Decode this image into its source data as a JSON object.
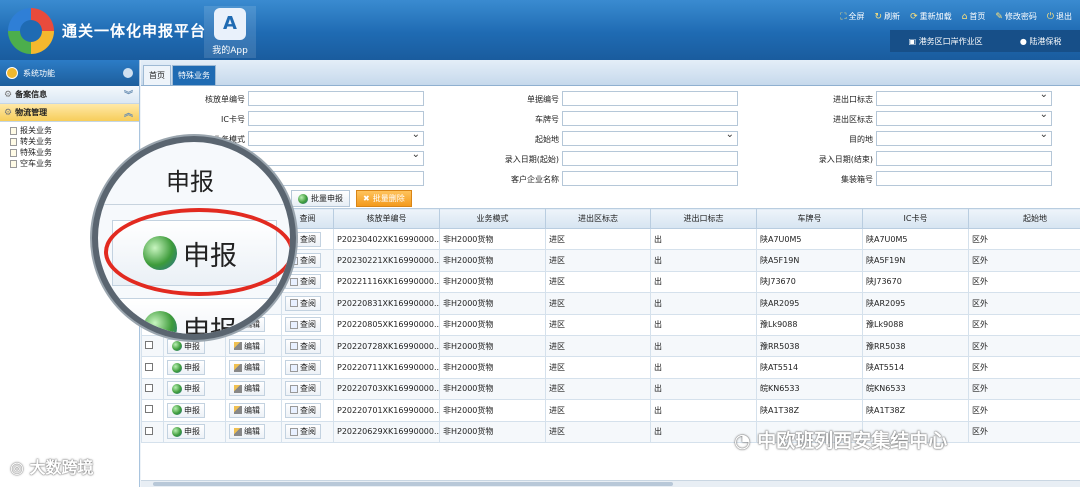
{
  "header": {
    "title": "通关一体化申报平台",
    "myapp_label": "我的App",
    "links": [
      {
        "icon": "fullscreen-icon",
        "label": "全屏"
      },
      {
        "icon": "refresh-icon",
        "label": "刷新"
      },
      {
        "icon": "reload-icon",
        "label": "重新加载"
      },
      {
        "icon": "home-icon",
        "label": "首页"
      },
      {
        "icon": "password-icon",
        "label": "修改密码"
      },
      {
        "icon": "logout-icon",
        "label": "退出"
      }
    ],
    "area": "港务区口岸作业区",
    "user": "陆港保税"
  },
  "sidebar": {
    "title": "系统功能",
    "groups": [
      {
        "label": "备案信息"
      },
      {
        "label": "物流管理"
      }
    ],
    "sub_items": [
      "报关业务",
      "转关业务",
      "特殊业务",
      "空车业务"
    ]
  },
  "tabs": [
    "首页",
    "特殊业务"
  ],
  "form": {
    "labels": {
      "verify_no": "核放单编号",
      "doc_no": "单据编号",
      "export_flag": "进出口标志",
      "ic_no": "IC卡号",
      "plate_no": "车牌号",
      "zone_flag": "进出区标志",
      "biz_mode": "业务模式",
      "origin": "起始地",
      "destination": "目的地",
      "entry_start": "录入日期(起始)",
      "entry_end": "录入日期(结束)",
      "customer": "客户企业名称",
      "container": "集装箱号"
    }
  },
  "actions": {
    "batch_declare": "批量申报",
    "batch_delete": "批量删除"
  },
  "table": {
    "headers": [
      "",
      "申报",
      "编辑",
      "查阅",
      "核放单编号",
      "业务模式",
      "进出区标志",
      "进出口标志",
      "车牌号",
      "IC卡号",
      "起始地"
    ],
    "declare_label": "申报",
    "edit_label": "编辑",
    "view_label": "查阅",
    "rows": [
      {
        "no": "P20230402XK16990000...",
        "mode": "非H2000货物",
        "zone": "进区",
        "io": "出",
        "plate": "陕A7U0M5",
        "ic": "陕A7U0M5",
        "origin": "区外"
      },
      {
        "no": "P20230221XK16990000...",
        "mode": "非H2000货物",
        "zone": "进区",
        "io": "出",
        "plate": "陕A5F19N",
        "ic": "陕A5F19N",
        "origin": "区外"
      },
      {
        "no": "P20221116XK16990000...",
        "mode": "非H2000货物",
        "zone": "进区",
        "io": "出",
        "plate": "陕J73670",
        "ic": "陕J73670",
        "origin": "区外"
      },
      {
        "no": "P20220831XK16990000...",
        "mode": "非H2000货物",
        "zone": "进区",
        "io": "出",
        "plate": "陕AR2095",
        "ic": "陕AR2095",
        "origin": "区外"
      },
      {
        "no": "P20220805XK16990000...",
        "mode": "非H2000货物",
        "zone": "进区",
        "io": "出",
        "plate": "豫Lk9088",
        "ic": "豫Lk9088",
        "origin": "区外"
      },
      {
        "no": "P20220728XK16990000...",
        "mode": "非H2000货物",
        "zone": "进区",
        "io": "出",
        "plate": "豫RR5038",
        "ic": "豫RR5038",
        "origin": "区外"
      },
      {
        "no": "P20220711XK16990000...",
        "mode": "非H2000货物",
        "zone": "进区",
        "io": "出",
        "plate": "陕AT5514",
        "ic": "陕AT5514",
        "origin": "区外"
      },
      {
        "no": "P20220703XK16990000...",
        "mode": "非H2000货物",
        "zone": "进区",
        "io": "出",
        "plate": "皖KN6533",
        "ic": "皖KN6533",
        "origin": "区外"
      },
      {
        "no": "P20220701XK16990000...",
        "mode": "非H2000货物",
        "zone": "进区",
        "io": "出",
        "plate": "陕A1T38Z",
        "ic": "陕A1T38Z",
        "origin": "区外"
      },
      {
        "no": "P20220629XK16990000...",
        "mode": "非H2000货物",
        "zone": "进区",
        "io": "出",
        "plate": "",
        "ic": "",
        "origin": "区外"
      }
    ]
  },
  "magnifier": {
    "title": "申报",
    "button": "申报"
  },
  "watermarks": {
    "left": "大数跨境",
    "right": "中欧班列西安集结中心"
  },
  "colors": {
    "header": "#1f6bb3",
    "accent_orange": "#f39a1e",
    "highlight_ring": "#e22a20"
  }
}
